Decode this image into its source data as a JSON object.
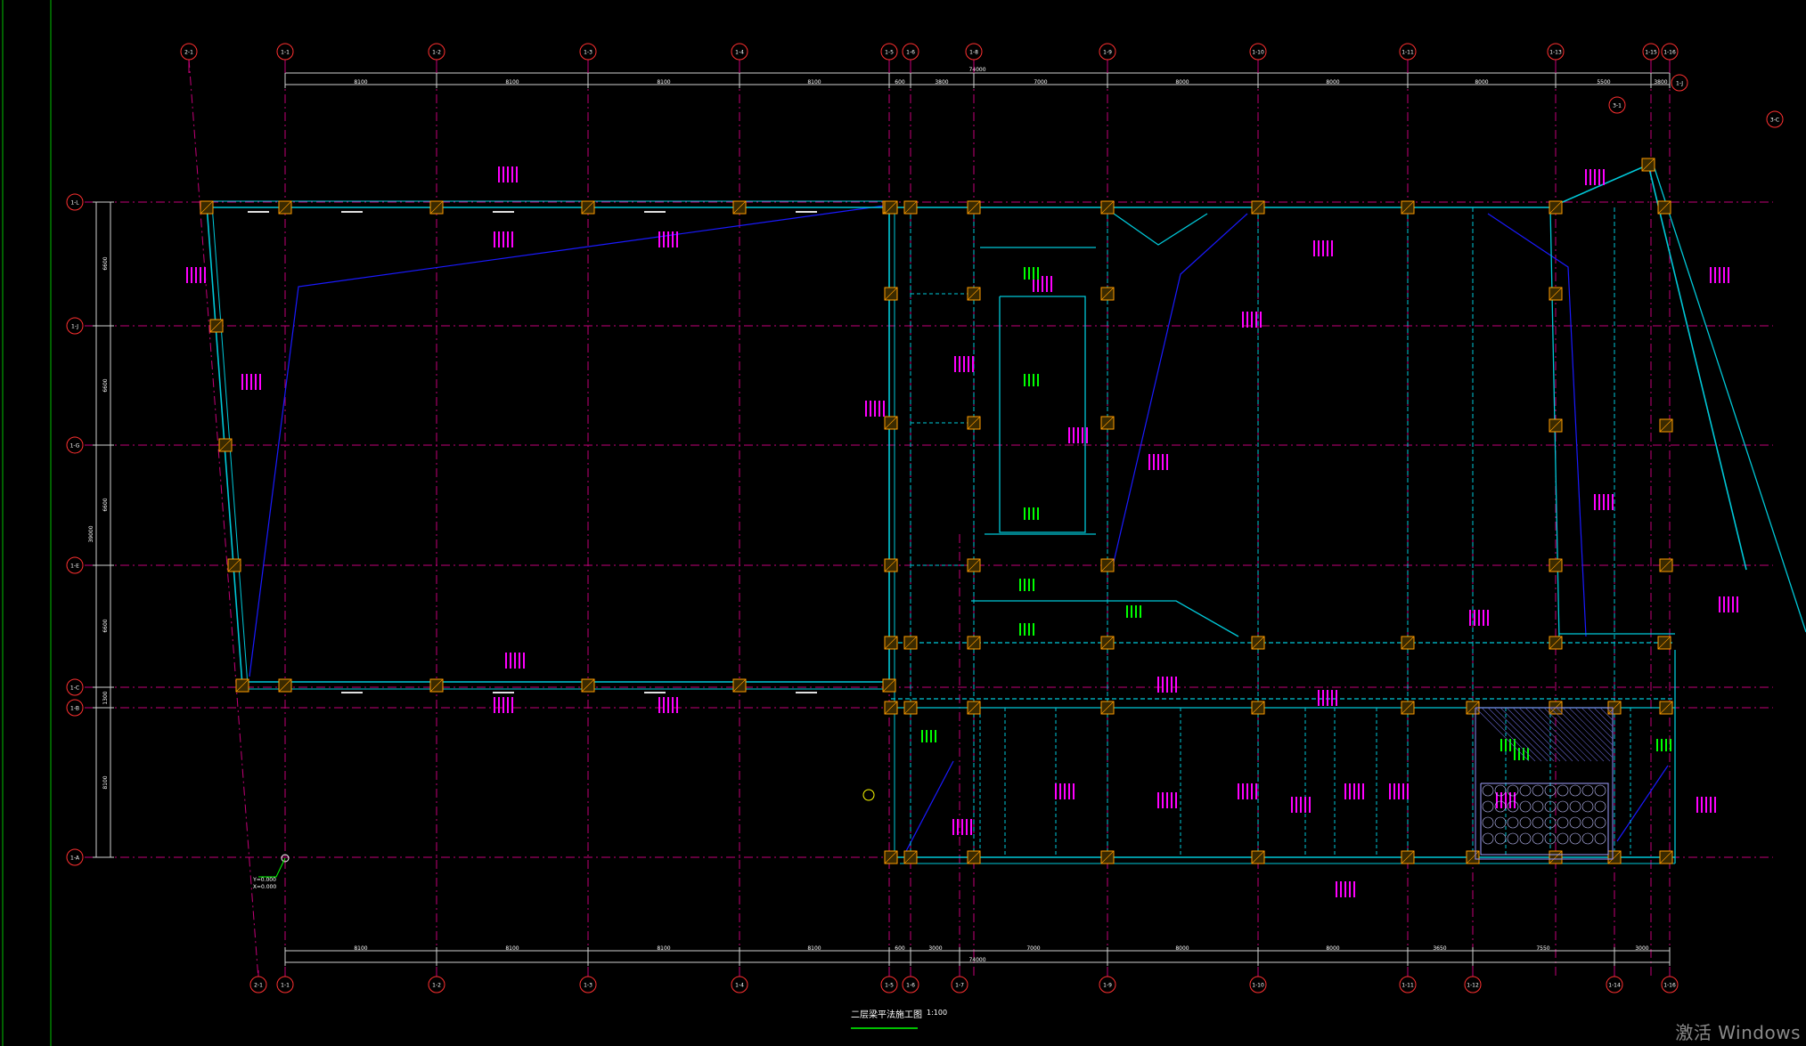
{
  "title": {
    "text": "二层梁平法施工图",
    "scale": "1:100"
  },
  "watermark": "激活 Windows",
  "grid": {
    "columns_top": [
      "2-1",
      "1-1",
      "1-2",
      "1-3",
      "1-4",
      "1-5",
      "1-6",
      "1-8",
      "1-9",
      "1-10",
      "1-11",
      "1-13",
      "1-15",
      "1-16"
    ],
    "columns_bottom": [
      "2-1",
      "1-1",
      "1-2",
      "1-3",
      "1-4",
      "1-5",
      "1-6",
      "1-7",
      "1-9",
      "1-10",
      "1-11",
      "1-12",
      "1-14",
      "1-16"
    ],
    "rows": [
      "1-L",
      "1-J",
      "1-G",
      "1-E",
      "1-C",
      "1-B",
      "1-A"
    ],
    "side_bubbles": [
      "1-J",
      "3-1",
      "3-C"
    ],
    "top_dimensions": [
      "8100",
      "8100",
      "8100",
      "8100",
      "600",
      "3800",
      "7000",
      "8000",
      "8000",
      "8000",
      "5500",
      "3800"
    ],
    "top_total": "74000",
    "bottom_dimensions": [
      "8100",
      "8100",
      "8100",
      "8100",
      "600",
      "3000",
      "7000",
      "8000",
      "8000",
      "3650",
      "7550",
      "3000"
    ],
    "bottom_total": "74000",
    "left_dimensions": [
      "6600",
      "6600",
      "6600",
      "6600",
      "1300",
      "8100"
    ],
    "left_total": "39000",
    "level_note": [
      "Y=0.000",
      "X=0.000"
    ]
  },
  "colors": {
    "grid_line": "#c40078",
    "axis_line": "#ff3fbf",
    "beam": "#00c8d8",
    "slab_edge": "#1a1aff",
    "annotation": "#ff00ff",
    "annotation_alt": "#00ff00",
    "dimension": "#ffffff",
    "column": "#ff9c00",
    "bubble": "#ff3030"
  }
}
